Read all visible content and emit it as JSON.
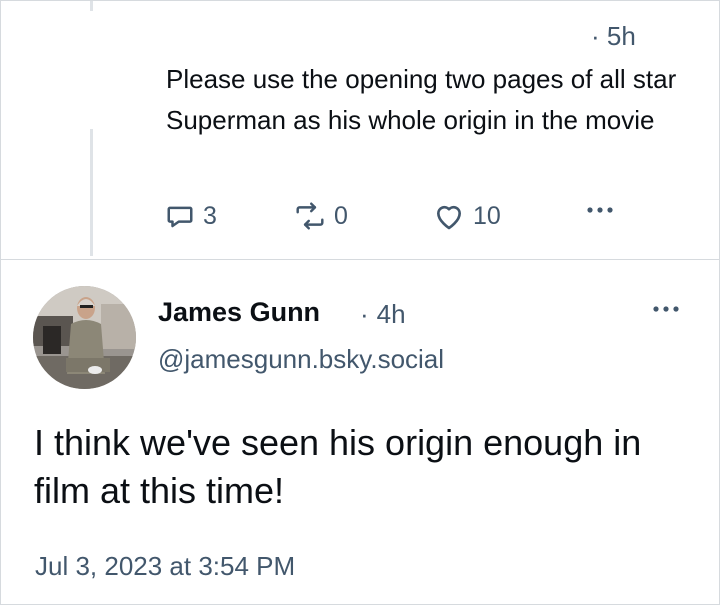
{
  "parent_post": {
    "time": "· 5h",
    "text": "Please use the opening two pages of all star Superman as his whole origin in the movie",
    "reply_count": "3",
    "repost_count": "0",
    "like_count": "10",
    "icons": {
      "reply": "reply-bubble-icon",
      "repost": "repost-icon",
      "like": "heart-icon",
      "more": "ellipsis-icon"
    }
  },
  "main_post": {
    "author_name": "James Gunn",
    "time_dot": "·",
    "time": "4h",
    "handle": "@jamesgunn.bsky.social",
    "text": "I think we've seen his origin enough in film at this time!",
    "timestamp": "Jul 3, 2023 at 3:54 PM"
  },
  "colors": {
    "text": "#0b0f14",
    "muted": "#42576c",
    "divider": "#d6dade",
    "thread_line": "#dfe3e7"
  }
}
